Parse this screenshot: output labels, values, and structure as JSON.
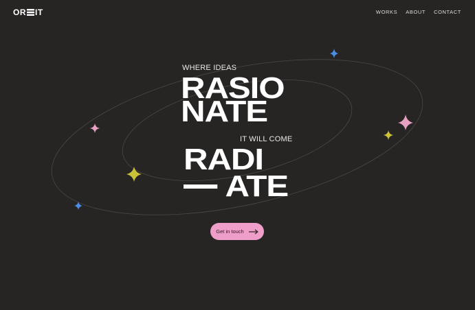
{
  "brand": {
    "logo_prefix": "OR",
    "logo_suffix": "IT"
  },
  "nav": {
    "items": [
      "WORKS",
      "ABOUT",
      "CONTACT"
    ]
  },
  "hero": {
    "eyebrow_1": "WHERE IDEAS",
    "line_1": "RASIO",
    "line_2": "NATE",
    "eyebrow_2": "IT WILL COME",
    "line_3": "RADI",
    "line_4": "ATE"
  },
  "cta": {
    "label": "Get in touch"
  },
  "colors": {
    "background": "#272524",
    "accent_pink": "#ee9ec8",
    "star_blue": "#4a8ee6",
    "star_pink": "#e7a0c2",
    "star_yellow": "#cbc23a",
    "orbit_line": "#4b4846"
  },
  "icons": {
    "cta_arrow": "arrow-right-icon",
    "sparkle": "sparkle-star-icon"
  }
}
